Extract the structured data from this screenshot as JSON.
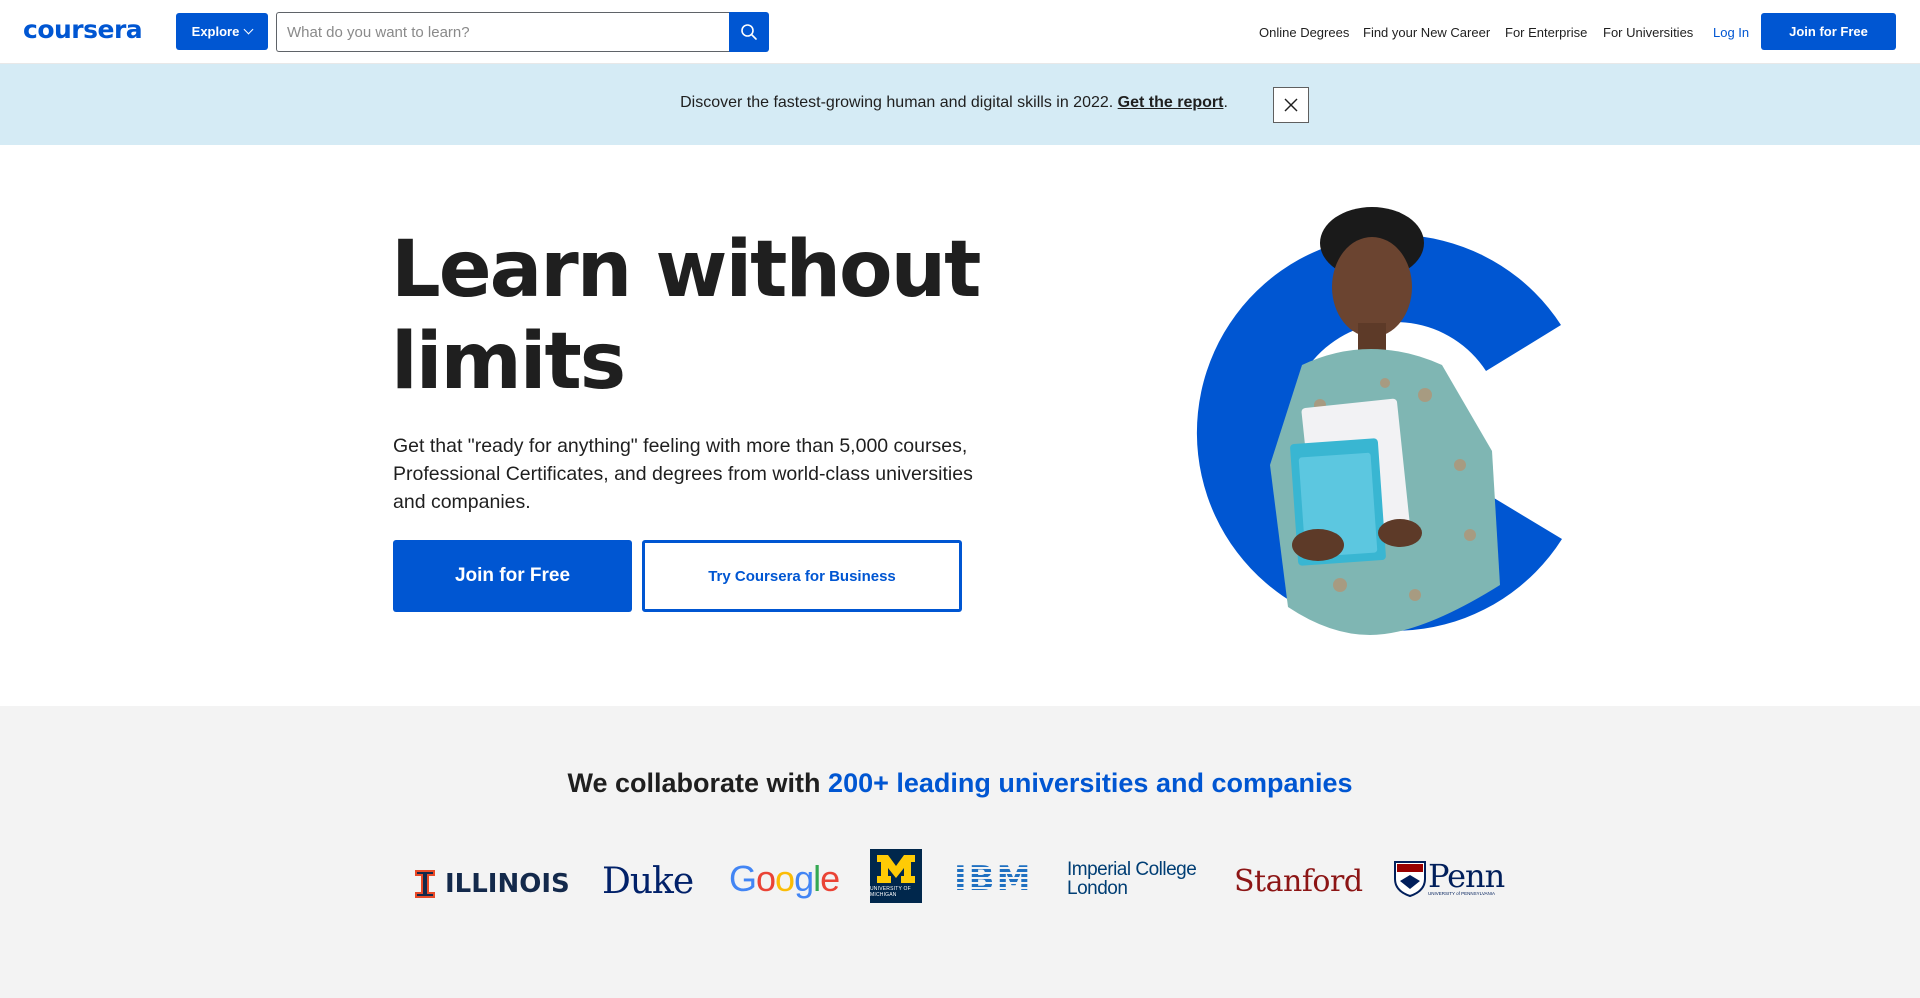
{
  "header": {
    "logo_text": "coursera",
    "explore_label": "Explore",
    "search_placeholder": "What do you want to learn?",
    "nav": {
      "online_degrees": "Online Degrees",
      "find_career": "Find your New Career",
      "enterprise": "For Enterprise",
      "universities": "For Universities",
      "login": "Log In",
      "join": "Join for Free"
    }
  },
  "banner": {
    "text": "Discover the fastest-growing human and digital skills in 2022.",
    "link": "Get the report",
    "suffix": "."
  },
  "hero": {
    "title": "Learn without limits",
    "subtitle": "Get that \"ready for anything\" feeling with more than 5,000 courses, Professional Certificates, and degrees from world-class universities and companies.",
    "primary_button": "Join for Free",
    "secondary_button": "Try Coursera for Business"
  },
  "partners": {
    "title_prefix": "We collaborate with ",
    "title_highlight": "200+ leading universities and companies",
    "logos": {
      "illinois": "ILLINOIS",
      "duke": "Duke",
      "google": "Google",
      "michigan": "UNIVERSITY OF MICHIGAN",
      "ibm": "IBM",
      "imperial_line1": "Imperial College",
      "imperial_line2": "London",
      "stanford": "Stanford",
      "penn": "Penn",
      "penn_sub": "UNIVERSITY of PENNSYLVANIA"
    }
  },
  "colors": {
    "brand_blue": "#0056d2",
    "banner_bg": "#d5ebf5",
    "partners_bg": "#f3f3f3",
    "stanford_red": "#8c1515",
    "michigan_navy": "#00274c",
    "michigan_maize": "#ffcb05"
  }
}
